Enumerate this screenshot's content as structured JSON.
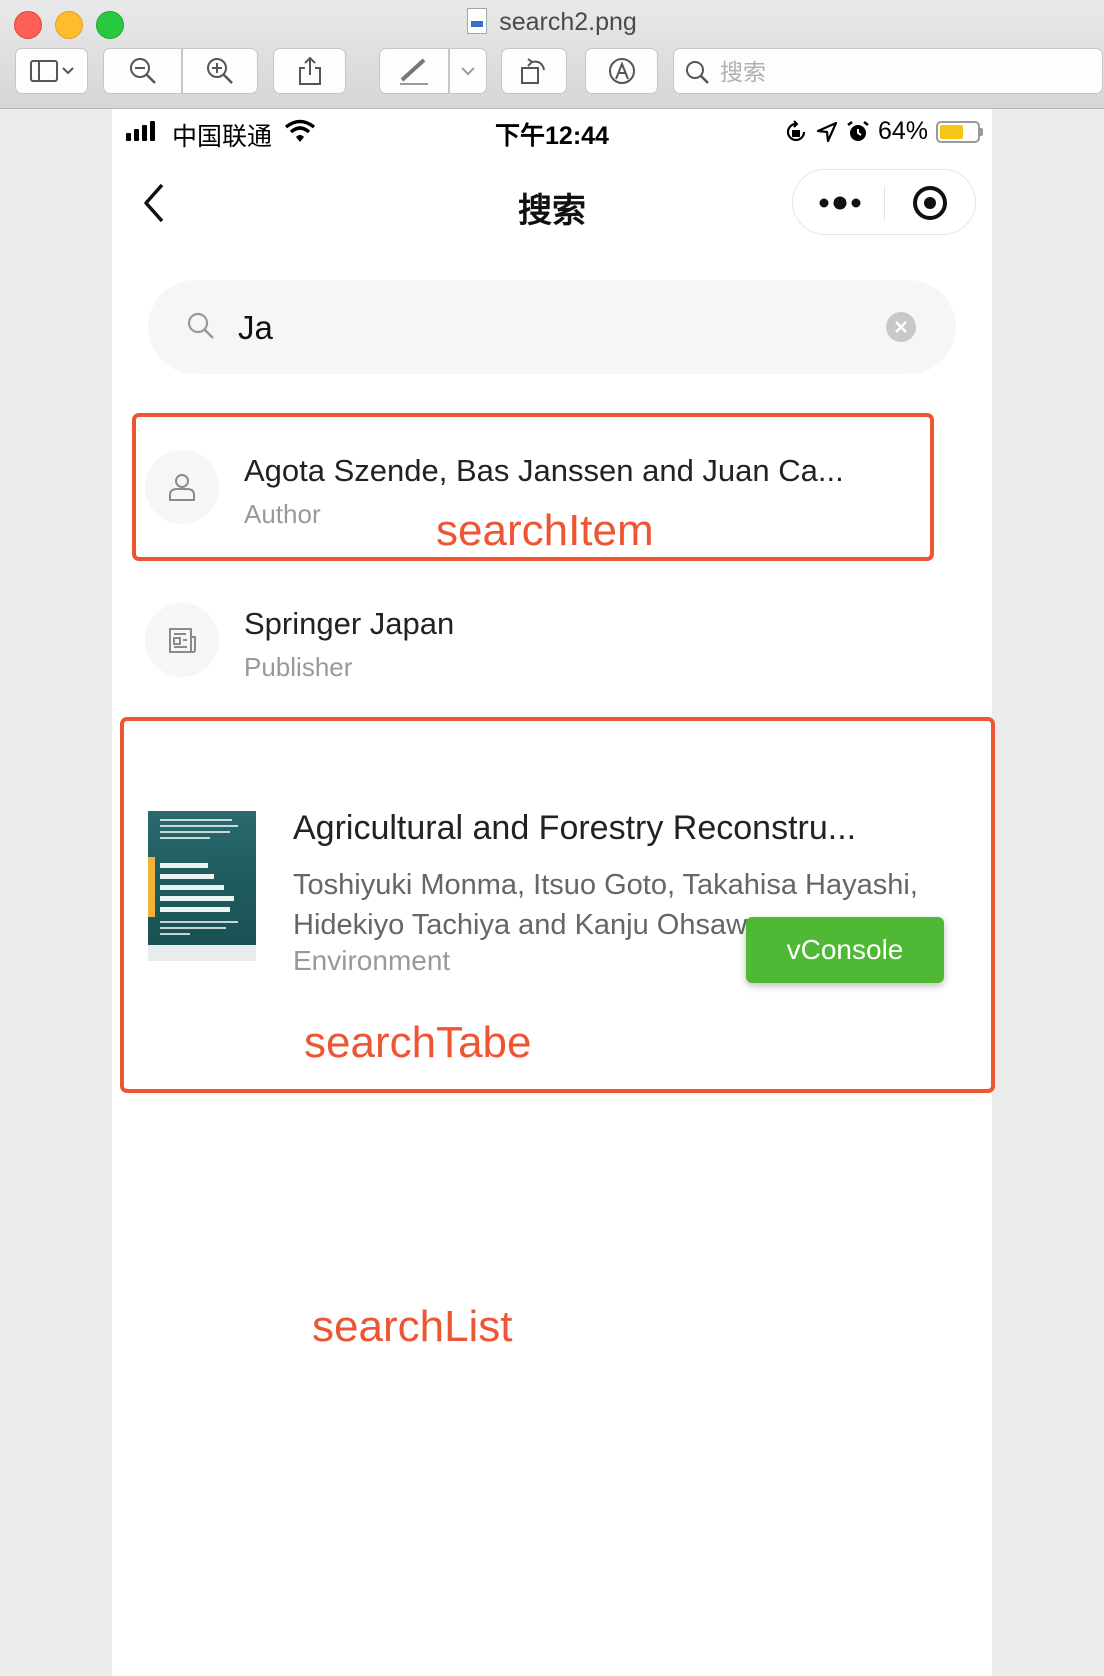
{
  "window": {
    "title": "search2.png",
    "search_placeholder": "搜索"
  },
  "phone": {
    "status": {
      "carrier": "中国联通",
      "time": "下午12:44",
      "battery": "64%",
      "battery_level": 0.64
    },
    "nav": {
      "title": "搜索"
    },
    "search": {
      "value": "Ja"
    },
    "results": [
      {
        "title": "Agota Szende, Bas Janssen and Juan Ca...",
        "type": "Author",
        "icon": "user-icon"
      },
      {
        "title": "Springer Japan",
        "type": "Publisher",
        "icon": "newspaper-icon"
      }
    ],
    "book": {
      "title": "Agricultural and Forestry Reconstru...",
      "authors": "Toshiyuki Monma, Itsuo Goto, Takahisa Hayashi, Hidekiyo Tachiya and Kanju Ohsawa",
      "category": "Environment"
    },
    "vconsole": "vConsole"
  },
  "annotations": {
    "search_item": "searchItem",
    "search_tabe": "searchTabe",
    "search_list": "searchList",
    "color": "#ee5533"
  }
}
